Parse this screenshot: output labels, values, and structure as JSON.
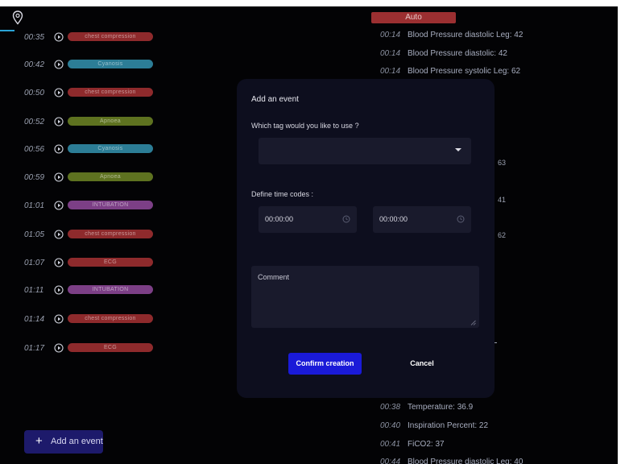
{
  "colors": {
    "background": "#030305",
    "modal_background": "#0d0e1e",
    "field_background": "#191a2c",
    "confirm_blue": "#1a1ad8",
    "add_event_purple": "#1d1a6b",
    "auto_red": "#9b2f31",
    "accent_cyan": "#2aa3d6"
  },
  "timeline": {
    "events": [
      {
        "time": "00:35",
        "tag": "chest compression",
        "color": "#8e2a2c"
      },
      {
        "time": "00:42",
        "tag": "Cyanosis",
        "color": "#2c7d96"
      },
      {
        "time": "00:50",
        "tag": "chest compression",
        "color": "#8e2a2c"
      },
      {
        "time": "00:52",
        "tag": "Apnoea",
        "color": "#5e7220"
      },
      {
        "time": "00:56",
        "tag": "Cyanosis",
        "color": "#2c7d96"
      },
      {
        "time": "00:59",
        "tag": "Apnoea",
        "color": "#5e7220"
      },
      {
        "time": "01:01",
        "tag": "INTUBATION",
        "color": "#7c3f86"
      },
      {
        "time": "01:05",
        "tag": "chest compression",
        "color": "#8e2a2c"
      },
      {
        "time": "01:07",
        "tag": "ECG",
        "color": "#8e2a2c"
      },
      {
        "time": "01:11",
        "tag": "INTUBATION",
        "color": "#7c3f86"
      },
      {
        "time": "01:14",
        "tag": "chest compression",
        "color": "#8e2a2c"
      },
      {
        "time": "01:17",
        "tag": "ECG",
        "color": "#8e2a2c"
      }
    ],
    "add_event_label": "Add an event"
  },
  "auto_log": {
    "header": "Auto",
    "entries_top": [
      {
        "time": "00:14",
        "text": "Blood Pressure diastolic Leg: 42"
      },
      {
        "time": "00:14",
        "text": "Blood Pressure diastolic: 42"
      },
      {
        "time": "00:14",
        "text": "Blood Pressure systolic Leg: 62"
      }
    ],
    "partial_values": [
      "63",
      "41",
      "62"
    ],
    "entries_bottom": [
      {
        "time": "00:38",
        "text": "Temperature: 36.9"
      },
      {
        "time": "00:40",
        "text": "Inspiration Percent: 22"
      },
      {
        "time": "00:41",
        "text": "FiCO2: 37"
      },
      {
        "time": "00:44",
        "text": "Blood Pressure diastolic Leg: 40"
      }
    ]
  },
  "modal": {
    "title": "Add an event",
    "tag_question": "Which tag would you like to use ?",
    "tag_select_value": "",
    "define_time_label": "Define time codes :",
    "start_time": "00:00:00",
    "end_time": "00:00:00",
    "comment_placeholder": "Comment",
    "confirm_label": "Confirm creation",
    "cancel_label": "Cancel"
  }
}
